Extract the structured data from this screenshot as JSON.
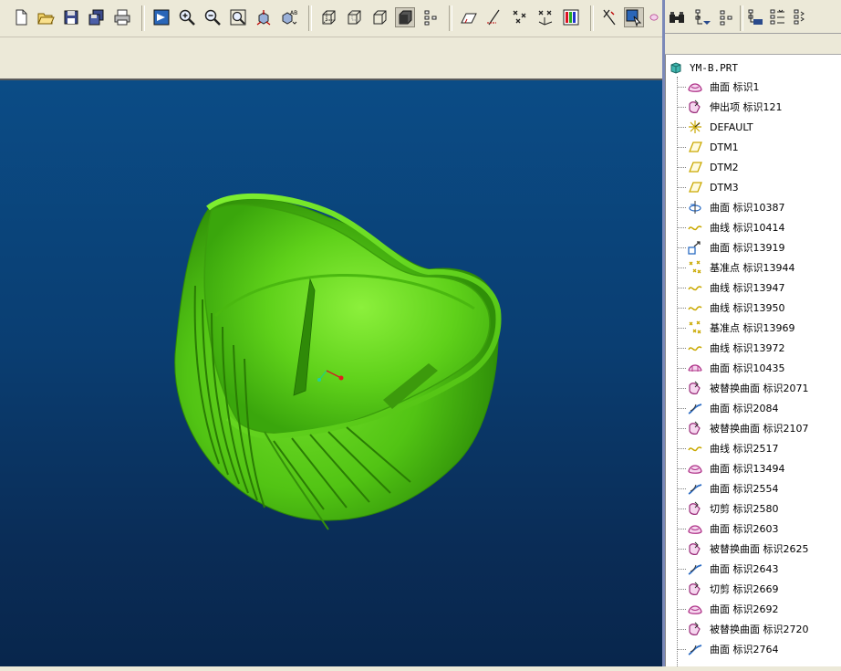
{
  "toolbar": {
    "buttons": [
      {
        "name": "new-icon"
      },
      {
        "name": "open-icon"
      },
      {
        "name": "save-icon"
      },
      {
        "name": "save-copy-icon"
      },
      {
        "name": "print-icon"
      },
      {
        "name": "redraw-icon"
      },
      {
        "name": "zoom-in-icon"
      },
      {
        "name": "zoom-out-icon"
      },
      {
        "name": "refit-icon"
      },
      {
        "name": "reorient-icon"
      },
      {
        "name": "saved-views-icon"
      },
      {
        "name": "wireframe-icon"
      },
      {
        "name": "hidden-line-icon"
      },
      {
        "name": "no-hidden-icon"
      },
      {
        "name": "shading-icon"
      },
      {
        "name": "model-tree-toggle-icon"
      },
      {
        "name": "datum-planes-icon"
      },
      {
        "name": "datum-axes-icon"
      },
      {
        "name": "datum-points-icon"
      },
      {
        "name": "coordinate-systems-icon"
      },
      {
        "name": "appearance-icon"
      },
      {
        "name": "context-help-icon"
      },
      {
        "name": "select-icon"
      },
      {
        "name": "feature-icon"
      }
    ]
  },
  "toolbar_right": {
    "buttons": [
      {
        "name": "find-icon"
      },
      {
        "name": "filter-icon"
      },
      {
        "name": "tree-columns-icon"
      },
      {
        "name": "show-icon"
      },
      {
        "name": "expand-icon"
      },
      {
        "name": "collapse-icon"
      }
    ]
  },
  "model_tree": {
    "root": "YM-B.PRT",
    "items": [
      {
        "label": "曲面 标识1",
        "icon": "surface-icon",
        "color": "#b0368a"
      },
      {
        "label": "伸出项 标识121",
        "icon": "protrusion-icon",
        "color": "#9a2d7a"
      },
      {
        "label": "DEFAULT",
        "icon": "csys-icon",
        "color": "#c9a800"
      },
      {
        "label": "DTM1",
        "icon": "datum-plane-icon",
        "color": "#c9a800"
      },
      {
        "label": "DTM2",
        "icon": "datum-plane-icon",
        "color": "#c9a800"
      },
      {
        "label": "DTM3",
        "icon": "datum-plane-icon",
        "color": "#c9a800"
      },
      {
        "label": "曲面 标识10387",
        "icon": "revolve-surface-icon",
        "color": "#2b6cc4"
      },
      {
        "label": "曲线 标识10414",
        "icon": "curve-icon",
        "color": "#c9a800"
      },
      {
        "label": "曲面 标识13919",
        "icon": "extrude-surface-icon",
        "color": "#2b6cc4"
      },
      {
        "label": "基准点 标识13944",
        "icon": "datum-point-icon",
        "color": "#c9a800"
      },
      {
        "label": "曲线 标识13947",
        "icon": "curve-icon",
        "color": "#c9a800"
      },
      {
        "label": "曲线 标识13950",
        "icon": "curve-icon",
        "color": "#c9a800"
      },
      {
        "label": "基准点 标识13969",
        "icon": "datum-point-icon",
        "color": "#c9a800"
      },
      {
        "label": "曲线 标识13972",
        "icon": "curve-icon",
        "color": "#c9a800"
      },
      {
        "label": "曲面 标识10435",
        "icon": "boundary-surface-icon",
        "color": "#b0368a"
      },
      {
        "label": "被替换曲面 标识2071",
        "icon": "replaced-surface-icon",
        "color": "#9a2d7a"
      },
      {
        "label": "曲面 标识2084",
        "icon": "sweep-surface-icon",
        "color": "#2b6cc4"
      },
      {
        "label": "被替换曲面 标识2107",
        "icon": "replaced-surface-icon",
        "color": "#9a2d7a"
      },
      {
        "label": "曲线 标识2517",
        "icon": "curve-icon",
        "color": "#c9a800"
      },
      {
        "label": "曲面 标识13494",
        "icon": "surface-icon",
        "color": "#b0368a"
      },
      {
        "label": "曲面 标识2554",
        "icon": "sweep-surface-icon",
        "color": "#2b6cc4"
      },
      {
        "label": "切剪 标识2580",
        "icon": "cut-icon",
        "color": "#9a2d7a"
      },
      {
        "label": "曲面 标识2603",
        "icon": "surface-icon",
        "color": "#b0368a"
      },
      {
        "label": "被替换曲面 标识2625",
        "icon": "replaced-surface-icon",
        "color": "#9a2d7a"
      },
      {
        "label": "曲面 标识2643",
        "icon": "sweep-surface-icon",
        "color": "#2b6cc4"
      },
      {
        "label": "切剪 标识2669",
        "icon": "cut-icon",
        "color": "#9a2d7a"
      },
      {
        "label": "曲面 标识2692",
        "icon": "surface-icon",
        "color": "#b0368a"
      },
      {
        "label": "被替换曲面 标识2720",
        "icon": "replaced-surface-icon",
        "color": "#9a2d7a"
      },
      {
        "label": "曲面 标识2764",
        "icon": "sweep-surface-icon",
        "color": "#2b6cc4"
      }
    ]
  },
  "viewport": {
    "background": "#0a3e72",
    "model_color": "#5fd11a"
  }
}
